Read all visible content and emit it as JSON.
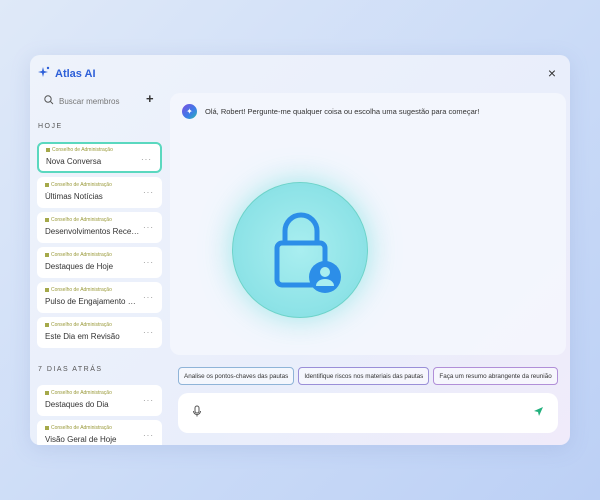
{
  "app": {
    "title": "Atlas AI",
    "close": "×"
  },
  "sidebar": {
    "search_placeholder": "Buscar membros",
    "add": "+",
    "sections": [
      {
        "label": "HOJE",
        "items": [
          {
            "tag": "Conselho de Administração",
            "name": "Nova Conversa",
            "active": true
          },
          {
            "tag": "Conselho de Administração",
            "name": "Últimas Notícias"
          },
          {
            "tag": "Conselho de Administração",
            "name": "Desenvolvimentos Recentes"
          },
          {
            "tag": "Conselho de Administração",
            "name": "Destaques de Hoje"
          },
          {
            "tag": "Conselho de Administração",
            "name": "Pulso de Engajamento Ch..."
          },
          {
            "tag": "Conselho de Administração",
            "name": "Este Dia em Revisão"
          }
        ]
      },
      {
        "label": "7 DIAS ATRÁS",
        "items": [
          {
            "tag": "Conselho de Administração",
            "name": "Destaques do Dia"
          },
          {
            "tag": "Conselho de Administração",
            "name": "Visão Geral de Hoje"
          }
        ]
      }
    ]
  },
  "chat": {
    "greeting": "Olá, Robert! Pergunte-me qualquer coisa ou escolha uma sugestão para começar!",
    "suggestions": [
      "Analise os pontos-chaves das pautas",
      "Identifique riscos nos materiais das pautas",
      "Faça um resumo abrangente da reunião"
    ],
    "input_placeholder": ""
  },
  "colors": {
    "accent": "#2d5fd8",
    "active_border": "#5ad8bf",
    "send": "#22b07d"
  }
}
